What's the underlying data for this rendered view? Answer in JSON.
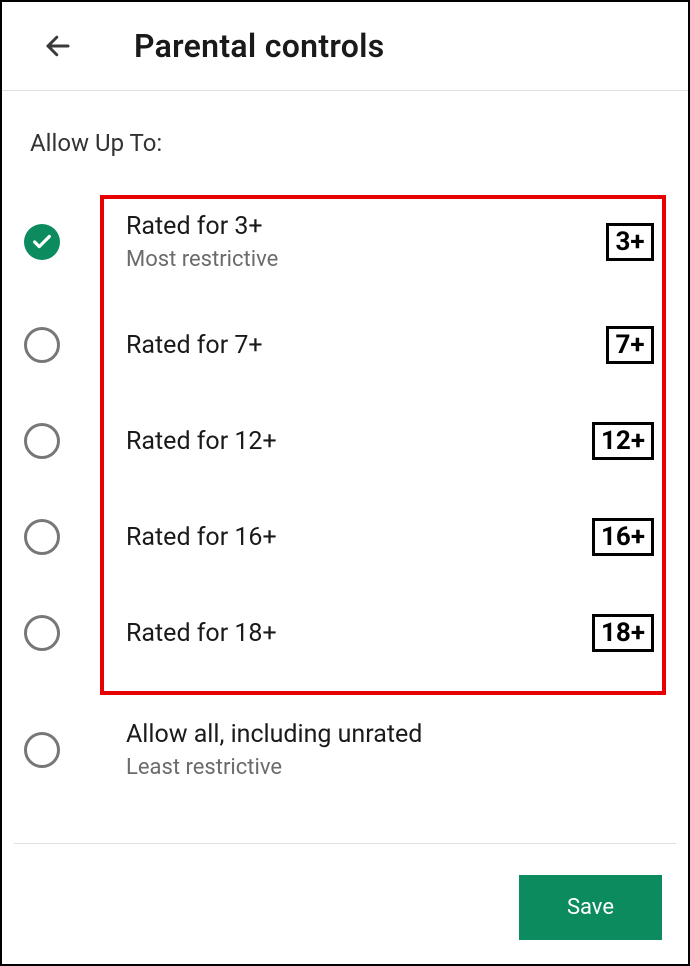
{
  "header": {
    "title": "Parental controls"
  },
  "sectionLabel": "Allow Up To:",
  "options": [
    {
      "label": "Rated for 3+",
      "sublabel": "Most restrictive",
      "badge": "3+",
      "selected": true
    },
    {
      "label": "Rated for 7+",
      "sublabel": "",
      "badge": "7+",
      "selected": false
    },
    {
      "label": "Rated for 12+",
      "sublabel": "",
      "badge": "12+",
      "selected": false
    },
    {
      "label": "Rated for 16+",
      "sublabel": "",
      "badge": "16+",
      "selected": false
    },
    {
      "label": "Rated for 18+",
      "sublabel": "",
      "badge": "18+",
      "selected": false
    },
    {
      "label": "Allow all, including unrated",
      "sublabel": "Least restrictive",
      "badge": "",
      "selected": false
    }
  ],
  "footer": {
    "saveLabel": "Save"
  },
  "colors": {
    "accent": "#0c8b5e",
    "highlight": "#e60000"
  }
}
